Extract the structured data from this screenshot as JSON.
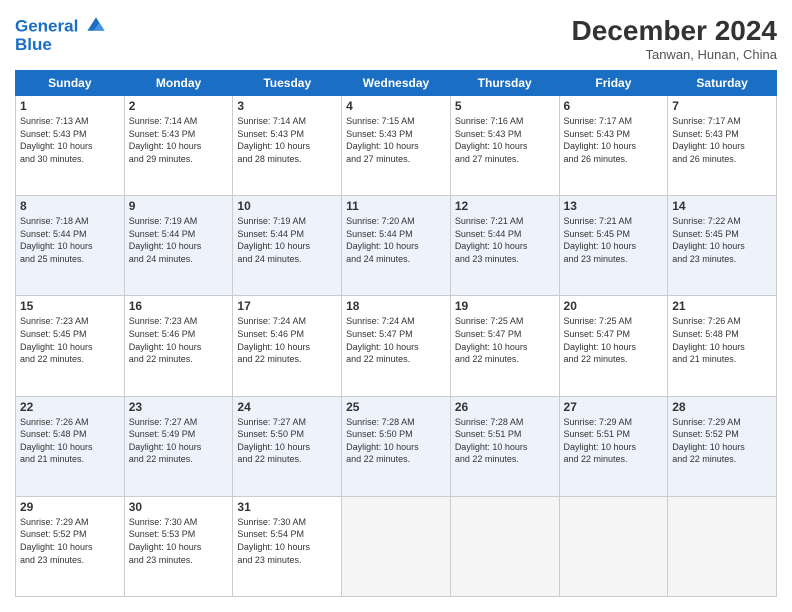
{
  "header": {
    "logo_line1": "General",
    "logo_line2": "Blue",
    "month_title": "December 2024",
    "subtitle": "Tanwan, Hunan, China"
  },
  "weekdays": [
    "Sunday",
    "Monday",
    "Tuesday",
    "Wednesday",
    "Thursday",
    "Friday",
    "Saturday"
  ],
  "weeks": [
    [
      {
        "day": "1",
        "info": "Sunrise: 7:13 AM\nSunset: 5:43 PM\nDaylight: 10 hours\nand 30 minutes."
      },
      {
        "day": "2",
        "info": "Sunrise: 7:14 AM\nSunset: 5:43 PM\nDaylight: 10 hours\nand 29 minutes."
      },
      {
        "day": "3",
        "info": "Sunrise: 7:14 AM\nSunset: 5:43 PM\nDaylight: 10 hours\nand 28 minutes."
      },
      {
        "day": "4",
        "info": "Sunrise: 7:15 AM\nSunset: 5:43 PM\nDaylight: 10 hours\nand 27 minutes."
      },
      {
        "day": "5",
        "info": "Sunrise: 7:16 AM\nSunset: 5:43 PM\nDaylight: 10 hours\nand 27 minutes."
      },
      {
        "day": "6",
        "info": "Sunrise: 7:17 AM\nSunset: 5:43 PM\nDaylight: 10 hours\nand 26 minutes."
      },
      {
        "day": "7",
        "info": "Sunrise: 7:17 AM\nSunset: 5:43 PM\nDaylight: 10 hours\nand 26 minutes."
      }
    ],
    [
      {
        "day": "8",
        "info": "Sunrise: 7:18 AM\nSunset: 5:44 PM\nDaylight: 10 hours\nand 25 minutes."
      },
      {
        "day": "9",
        "info": "Sunrise: 7:19 AM\nSunset: 5:44 PM\nDaylight: 10 hours\nand 24 minutes."
      },
      {
        "day": "10",
        "info": "Sunrise: 7:19 AM\nSunset: 5:44 PM\nDaylight: 10 hours\nand 24 minutes."
      },
      {
        "day": "11",
        "info": "Sunrise: 7:20 AM\nSunset: 5:44 PM\nDaylight: 10 hours\nand 24 minutes."
      },
      {
        "day": "12",
        "info": "Sunrise: 7:21 AM\nSunset: 5:44 PM\nDaylight: 10 hours\nand 23 minutes."
      },
      {
        "day": "13",
        "info": "Sunrise: 7:21 AM\nSunset: 5:45 PM\nDaylight: 10 hours\nand 23 minutes."
      },
      {
        "day": "14",
        "info": "Sunrise: 7:22 AM\nSunset: 5:45 PM\nDaylight: 10 hours\nand 23 minutes."
      }
    ],
    [
      {
        "day": "15",
        "info": "Sunrise: 7:23 AM\nSunset: 5:45 PM\nDaylight: 10 hours\nand 22 minutes."
      },
      {
        "day": "16",
        "info": "Sunrise: 7:23 AM\nSunset: 5:46 PM\nDaylight: 10 hours\nand 22 minutes."
      },
      {
        "day": "17",
        "info": "Sunrise: 7:24 AM\nSunset: 5:46 PM\nDaylight: 10 hours\nand 22 minutes."
      },
      {
        "day": "18",
        "info": "Sunrise: 7:24 AM\nSunset: 5:47 PM\nDaylight: 10 hours\nand 22 minutes."
      },
      {
        "day": "19",
        "info": "Sunrise: 7:25 AM\nSunset: 5:47 PM\nDaylight: 10 hours\nand 22 minutes."
      },
      {
        "day": "20",
        "info": "Sunrise: 7:25 AM\nSunset: 5:47 PM\nDaylight: 10 hours\nand 22 minutes."
      },
      {
        "day": "21",
        "info": "Sunrise: 7:26 AM\nSunset: 5:48 PM\nDaylight: 10 hours\nand 21 minutes."
      }
    ],
    [
      {
        "day": "22",
        "info": "Sunrise: 7:26 AM\nSunset: 5:48 PM\nDaylight: 10 hours\nand 21 minutes."
      },
      {
        "day": "23",
        "info": "Sunrise: 7:27 AM\nSunset: 5:49 PM\nDaylight: 10 hours\nand 22 minutes."
      },
      {
        "day": "24",
        "info": "Sunrise: 7:27 AM\nSunset: 5:50 PM\nDaylight: 10 hours\nand 22 minutes."
      },
      {
        "day": "25",
        "info": "Sunrise: 7:28 AM\nSunset: 5:50 PM\nDaylight: 10 hours\nand 22 minutes."
      },
      {
        "day": "26",
        "info": "Sunrise: 7:28 AM\nSunset: 5:51 PM\nDaylight: 10 hours\nand 22 minutes."
      },
      {
        "day": "27",
        "info": "Sunrise: 7:29 AM\nSunset: 5:51 PM\nDaylight: 10 hours\nand 22 minutes."
      },
      {
        "day": "28",
        "info": "Sunrise: 7:29 AM\nSunset: 5:52 PM\nDaylight: 10 hours\nand 22 minutes."
      }
    ],
    [
      {
        "day": "29",
        "info": "Sunrise: 7:29 AM\nSunset: 5:52 PM\nDaylight: 10 hours\nand 23 minutes."
      },
      {
        "day": "30",
        "info": "Sunrise: 7:30 AM\nSunset: 5:53 PM\nDaylight: 10 hours\nand 23 minutes."
      },
      {
        "day": "31",
        "info": "Sunrise: 7:30 AM\nSunset: 5:54 PM\nDaylight: 10 hours\nand 23 minutes."
      },
      null,
      null,
      null,
      null
    ]
  ]
}
